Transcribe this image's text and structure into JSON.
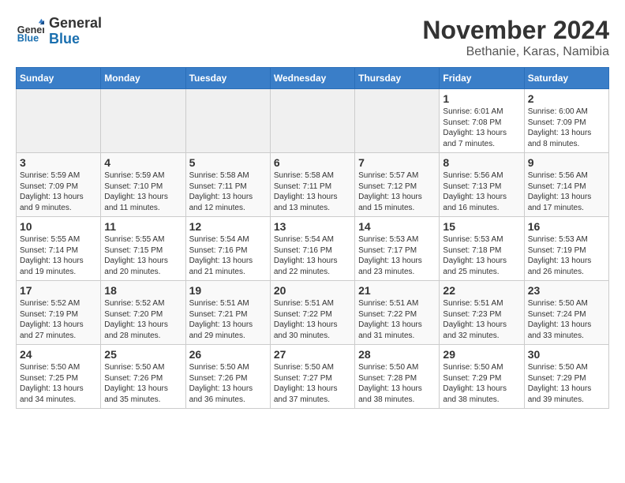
{
  "logo": {
    "line1": "General",
    "line2": "Blue"
  },
  "title": "November 2024",
  "subtitle": "Bethanie, Karas, Namibia",
  "weekdays": [
    "Sunday",
    "Monday",
    "Tuesday",
    "Wednesday",
    "Thursday",
    "Friday",
    "Saturday"
  ],
  "weeks": [
    [
      {
        "day": "",
        "info": ""
      },
      {
        "day": "",
        "info": ""
      },
      {
        "day": "",
        "info": ""
      },
      {
        "day": "",
        "info": ""
      },
      {
        "day": "",
        "info": ""
      },
      {
        "day": "1",
        "info": "Sunrise: 6:01 AM\nSunset: 7:08 PM\nDaylight: 13 hours\nand 7 minutes."
      },
      {
        "day": "2",
        "info": "Sunrise: 6:00 AM\nSunset: 7:09 PM\nDaylight: 13 hours\nand 8 minutes."
      }
    ],
    [
      {
        "day": "3",
        "info": "Sunrise: 5:59 AM\nSunset: 7:09 PM\nDaylight: 13 hours\nand 9 minutes."
      },
      {
        "day": "4",
        "info": "Sunrise: 5:59 AM\nSunset: 7:10 PM\nDaylight: 13 hours\nand 11 minutes."
      },
      {
        "day": "5",
        "info": "Sunrise: 5:58 AM\nSunset: 7:11 PM\nDaylight: 13 hours\nand 12 minutes."
      },
      {
        "day": "6",
        "info": "Sunrise: 5:58 AM\nSunset: 7:11 PM\nDaylight: 13 hours\nand 13 minutes."
      },
      {
        "day": "7",
        "info": "Sunrise: 5:57 AM\nSunset: 7:12 PM\nDaylight: 13 hours\nand 15 minutes."
      },
      {
        "day": "8",
        "info": "Sunrise: 5:56 AM\nSunset: 7:13 PM\nDaylight: 13 hours\nand 16 minutes."
      },
      {
        "day": "9",
        "info": "Sunrise: 5:56 AM\nSunset: 7:14 PM\nDaylight: 13 hours\nand 17 minutes."
      }
    ],
    [
      {
        "day": "10",
        "info": "Sunrise: 5:55 AM\nSunset: 7:14 PM\nDaylight: 13 hours\nand 19 minutes."
      },
      {
        "day": "11",
        "info": "Sunrise: 5:55 AM\nSunset: 7:15 PM\nDaylight: 13 hours\nand 20 minutes."
      },
      {
        "day": "12",
        "info": "Sunrise: 5:54 AM\nSunset: 7:16 PM\nDaylight: 13 hours\nand 21 minutes."
      },
      {
        "day": "13",
        "info": "Sunrise: 5:54 AM\nSunset: 7:16 PM\nDaylight: 13 hours\nand 22 minutes."
      },
      {
        "day": "14",
        "info": "Sunrise: 5:53 AM\nSunset: 7:17 PM\nDaylight: 13 hours\nand 23 minutes."
      },
      {
        "day": "15",
        "info": "Sunrise: 5:53 AM\nSunset: 7:18 PM\nDaylight: 13 hours\nand 25 minutes."
      },
      {
        "day": "16",
        "info": "Sunrise: 5:53 AM\nSunset: 7:19 PM\nDaylight: 13 hours\nand 26 minutes."
      }
    ],
    [
      {
        "day": "17",
        "info": "Sunrise: 5:52 AM\nSunset: 7:19 PM\nDaylight: 13 hours\nand 27 minutes."
      },
      {
        "day": "18",
        "info": "Sunrise: 5:52 AM\nSunset: 7:20 PM\nDaylight: 13 hours\nand 28 minutes."
      },
      {
        "day": "19",
        "info": "Sunrise: 5:51 AM\nSunset: 7:21 PM\nDaylight: 13 hours\nand 29 minutes."
      },
      {
        "day": "20",
        "info": "Sunrise: 5:51 AM\nSunset: 7:22 PM\nDaylight: 13 hours\nand 30 minutes."
      },
      {
        "day": "21",
        "info": "Sunrise: 5:51 AM\nSunset: 7:22 PM\nDaylight: 13 hours\nand 31 minutes."
      },
      {
        "day": "22",
        "info": "Sunrise: 5:51 AM\nSunset: 7:23 PM\nDaylight: 13 hours\nand 32 minutes."
      },
      {
        "day": "23",
        "info": "Sunrise: 5:50 AM\nSunset: 7:24 PM\nDaylight: 13 hours\nand 33 minutes."
      }
    ],
    [
      {
        "day": "24",
        "info": "Sunrise: 5:50 AM\nSunset: 7:25 PM\nDaylight: 13 hours\nand 34 minutes."
      },
      {
        "day": "25",
        "info": "Sunrise: 5:50 AM\nSunset: 7:26 PM\nDaylight: 13 hours\nand 35 minutes."
      },
      {
        "day": "26",
        "info": "Sunrise: 5:50 AM\nSunset: 7:26 PM\nDaylight: 13 hours\nand 36 minutes."
      },
      {
        "day": "27",
        "info": "Sunrise: 5:50 AM\nSunset: 7:27 PM\nDaylight: 13 hours\nand 37 minutes."
      },
      {
        "day": "28",
        "info": "Sunrise: 5:50 AM\nSunset: 7:28 PM\nDaylight: 13 hours\nand 38 minutes."
      },
      {
        "day": "29",
        "info": "Sunrise: 5:50 AM\nSunset: 7:29 PM\nDaylight: 13 hours\nand 38 minutes."
      },
      {
        "day": "30",
        "info": "Sunrise: 5:50 AM\nSunset: 7:29 PM\nDaylight: 13 hours\nand 39 minutes."
      }
    ]
  ]
}
